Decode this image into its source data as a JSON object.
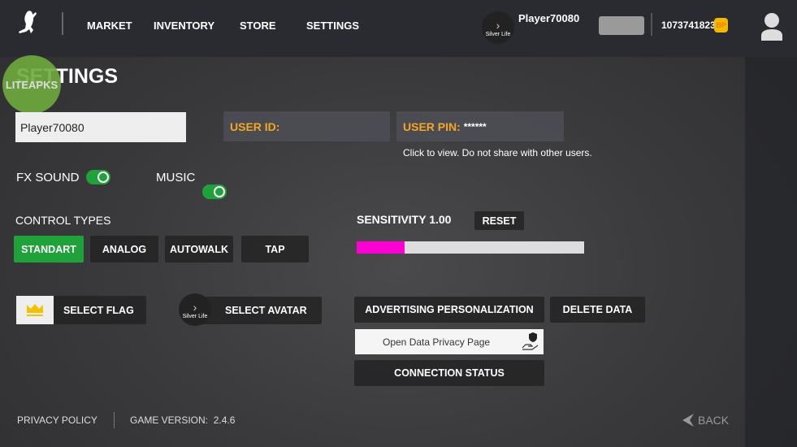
{
  "nav": {
    "items": [
      "MARKET",
      "INVENTORY",
      "STORE",
      "SETTINGS"
    ]
  },
  "header": {
    "player_name": "Player70080",
    "badge_label": "Silver Life",
    "currency": "1073741823",
    "currency_icon": "BP"
  },
  "page": {
    "title": "SETTINGS",
    "watermark": "LITEAPKS"
  },
  "account": {
    "username": "Player70080",
    "user_id_label": "USER ID:",
    "user_id_value": "",
    "user_pin_label": "USER PIN:",
    "user_pin_value": "******",
    "pin_note": "Click to view. Do not share with other users."
  },
  "audio": {
    "fx_label": "FX SOUND",
    "fx_on": true,
    "music_label": "MUSIC",
    "music_on": true
  },
  "controls": {
    "label": "CONTROL TYPES",
    "options": [
      "STANDART",
      "ANALOG",
      "AUTOWALK",
      "TAP"
    ],
    "selected": "STANDART"
  },
  "sensitivity": {
    "label": "SENSITIVITY",
    "value": "1.00",
    "reset_label": "RESET",
    "fill_percent": 21,
    "fill_color": "#ff00d4"
  },
  "buttons": {
    "select_flag": "SELECT FLAG",
    "select_avatar": "SELECT AVATAR",
    "avatar_badge": "Silver Life",
    "ad_personalization": "ADVERTISING PERSONALIZATION",
    "delete_data": "DELETE DATA",
    "privacy_page": "Open Data Privacy Page",
    "connection_status": "CONNECTION STATUS"
  },
  "footer": {
    "privacy_policy": "PRIVACY POLICY",
    "version_label": "GAME VERSION:",
    "version": "2.4.6",
    "back": "BACK"
  },
  "colors": {
    "accent_green": "#1fa23a",
    "orange": "#f5a623"
  }
}
